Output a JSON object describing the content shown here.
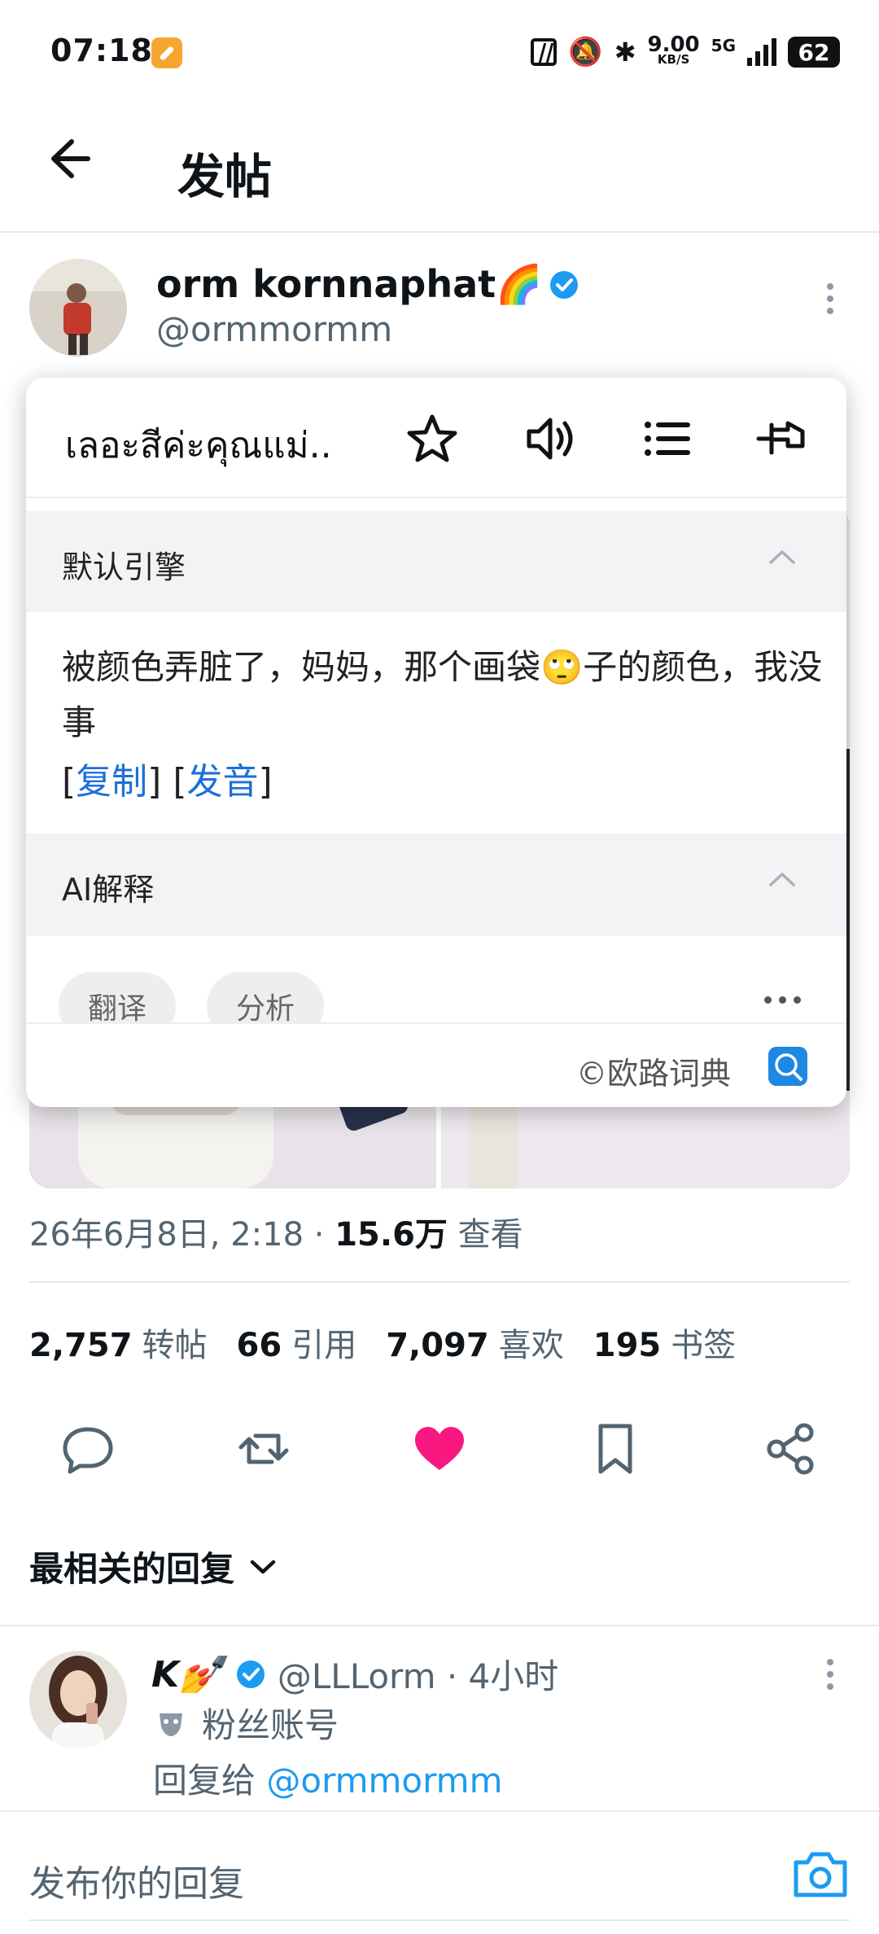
{
  "status_bar": {
    "time": "07:18",
    "speed_value": "9.00",
    "speed_unit": "KB/S",
    "network": "5G",
    "battery": "62"
  },
  "header": {
    "title": "发帖"
  },
  "post": {
    "author_name": "orm kornnaphat🌈",
    "author_handle": "@ormmormm",
    "timestamp": "26年6月8日, 2:18 ·",
    "views_count": "15.6万",
    "views_label": "查看"
  },
  "stats": {
    "reposts_count": "2,757",
    "reposts_label": "转帖",
    "quotes_count": "66",
    "quotes_label": "引用",
    "likes_count": "7,097",
    "likes_label": "喜欢",
    "bookmarks_count": "195",
    "bookmarks_label": "书签"
  },
  "dictionary_popup": {
    "word": "เลอะสีค่ะคุณแม่..",
    "engine_section_title": "默认引擎",
    "translation": "被颜色弄脏了，妈妈，那个画袋🙄子的颜色，我没事",
    "copy_link": "复制",
    "pronounce_link": "发音",
    "ai_section_title": "AI解释",
    "chip_translate": "翻译",
    "chip_analyze": "分析",
    "credit": "©欧路词典"
  },
  "replies": {
    "sort_label": "最相关的回复",
    "items": [
      {
        "name": "K💅",
        "handle": "@LLLorm · 4小时",
        "badge": "粉丝账号",
        "reply_to_prefix": "回复给",
        "reply_to_mention": "@ormmormm"
      }
    ]
  },
  "composer": {
    "placeholder": "发布你的回复"
  },
  "colors": {
    "accent": "#1d9bf0",
    "like": "#f91880",
    "dict_link": "#1d6fd8",
    "secondary_text": "#536471"
  }
}
